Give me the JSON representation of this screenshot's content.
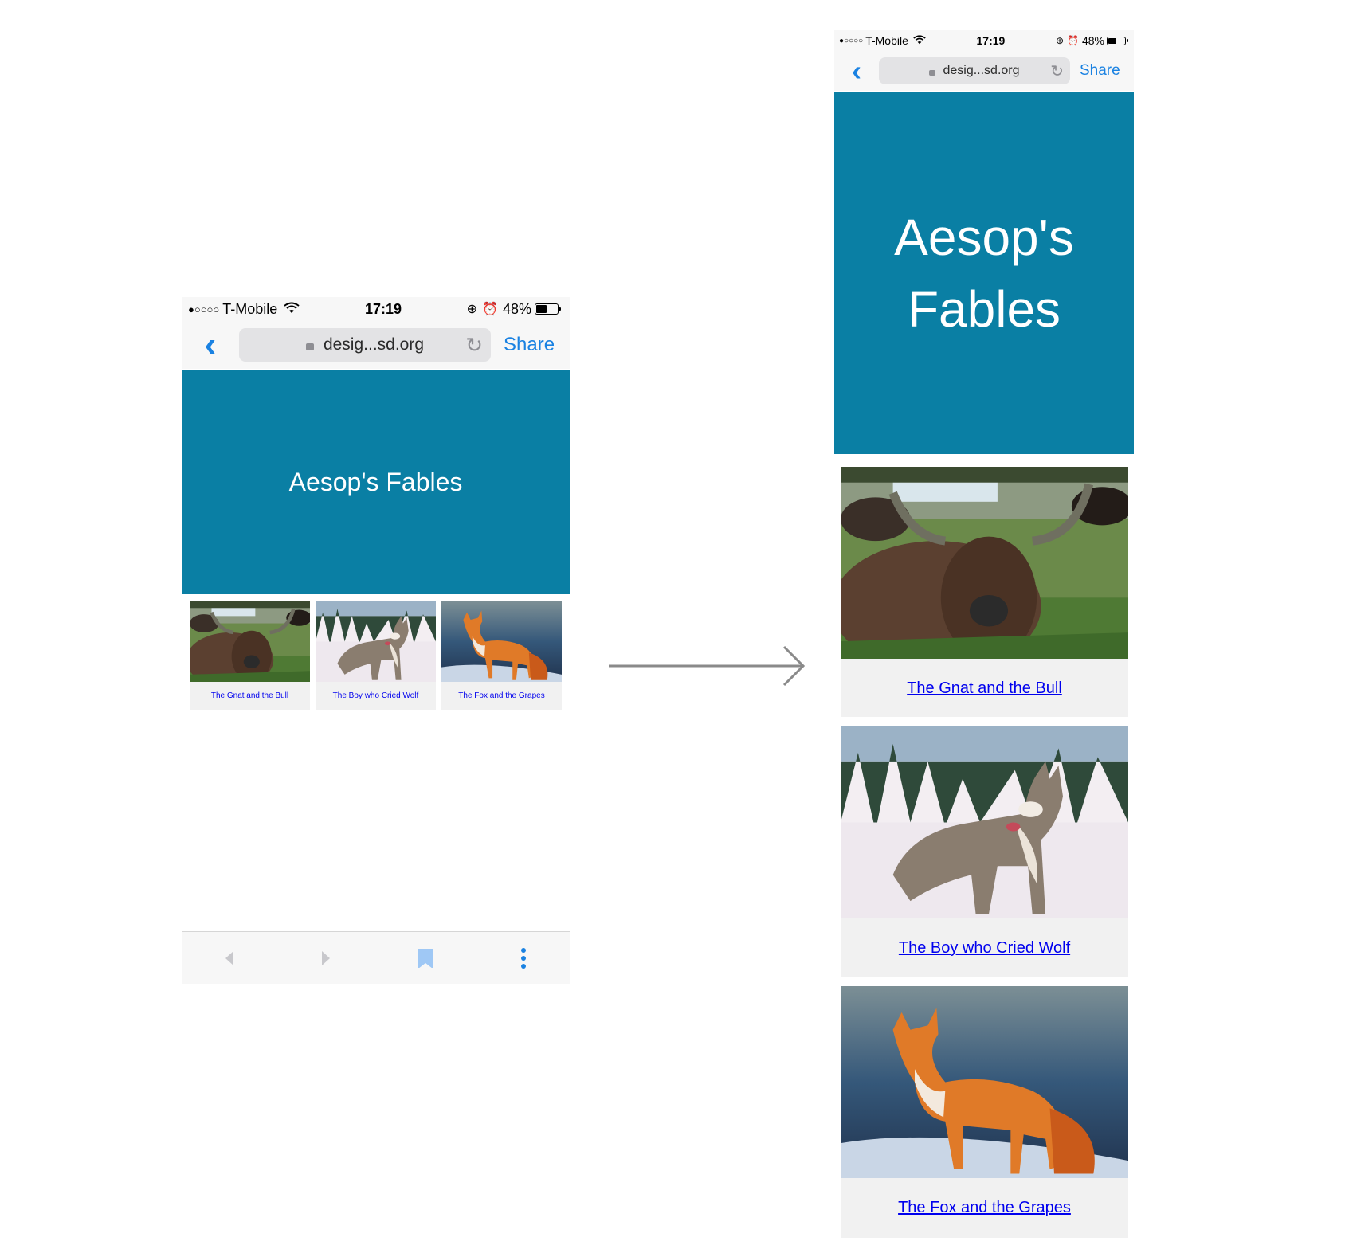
{
  "status": {
    "signal_dots": "●○○○○",
    "carrier": "T-Mobile",
    "time": "17:19",
    "battery": "48%",
    "battery_level": 0.48
  },
  "browser": {
    "url": "desig...sd.org",
    "share_label": "Share",
    "back_glyph": "‹",
    "reload_glyph": "↻"
  },
  "hero": {
    "title": "Aesop's Fables",
    "title_line1": "Aesop's",
    "title_line2": "Fables",
    "color": "#0a7fa4"
  },
  "cards": [
    {
      "title": "The Gnat and the Bull",
      "image": "highland-bull-photo"
    },
    {
      "title": "The Boy who Cried Wolf",
      "image": "wolf-in-snow-photo"
    },
    {
      "title": "The Fox and the Grapes",
      "image": "red-fox-photo"
    }
  ],
  "toolbar": {
    "icons": [
      "back-arrow-icon",
      "forward-arrow-icon",
      "bookmark-icon",
      "more-icon"
    ]
  },
  "colors": {
    "accent": "#1a82e2",
    "link": "#0000ee",
    "card_bg": "#f1f1f1"
  }
}
